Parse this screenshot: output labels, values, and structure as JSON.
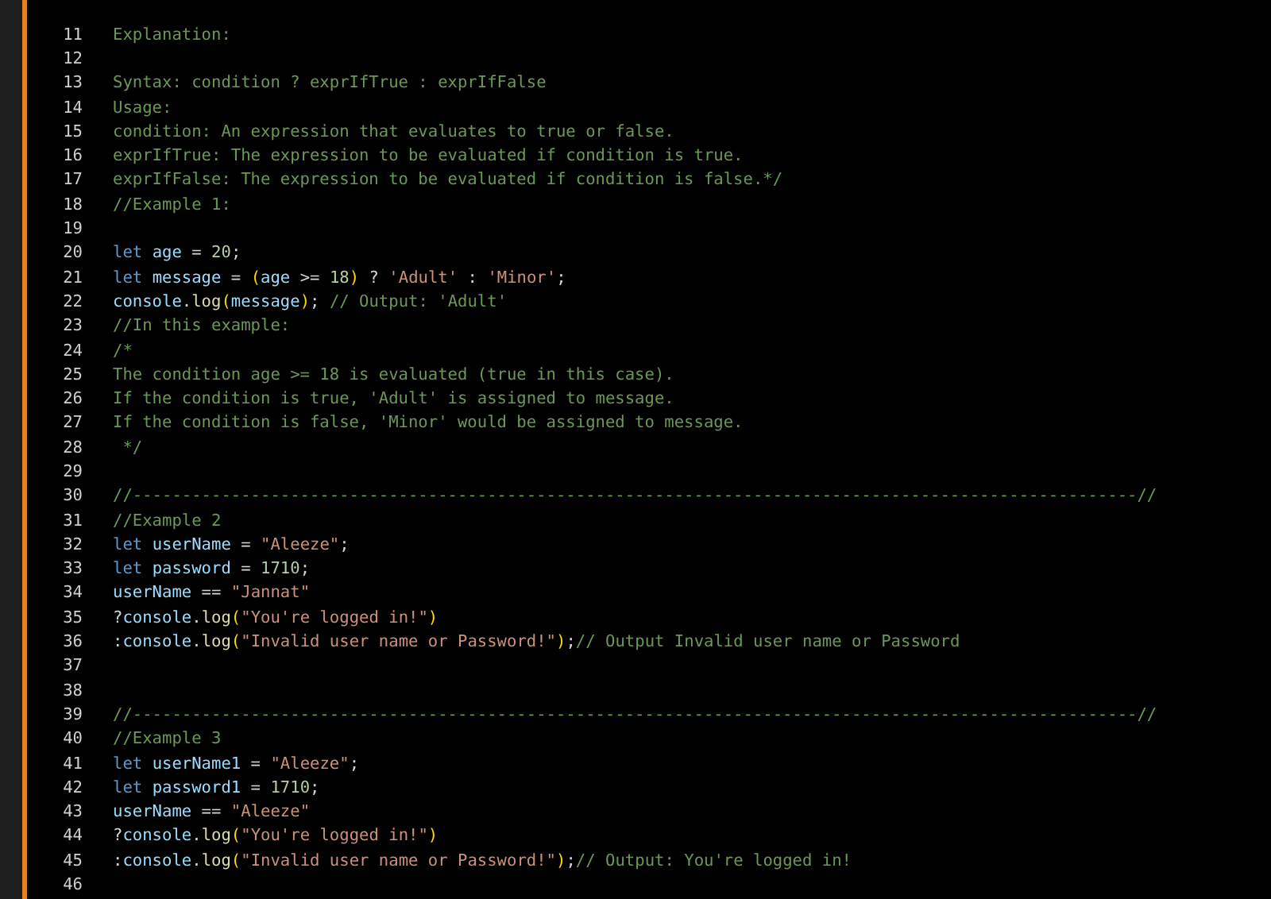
{
  "editor": {
    "lines": [
      {
        "number": "11",
        "tokens": [
          {
            "kind": "comment",
            "text": "Explanation:"
          }
        ]
      },
      {
        "number": "12"
      },
      {
        "number": "13",
        "tokens": [
          {
            "kind": "comment",
            "text": "Syntax: condition ? exprIfTrue : exprIfFalse"
          }
        ]
      },
      {
        "number": "14",
        "tokens": [
          {
            "kind": "comment",
            "text": "Usage:"
          }
        ]
      },
      {
        "number": "15",
        "tokens": [
          {
            "kind": "comment",
            "text": "condition: An expression that evaluates to true or false."
          }
        ]
      },
      {
        "number": "16",
        "tokens": [
          {
            "kind": "comment",
            "text": "exprIfTrue: The expression to be evaluated if condition is true."
          }
        ]
      },
      {
        "number": "17",
        "tokens": [
          {
            "kind": "comment",
            "text": "exprIfFalse: The expression to be evaluated if condition is false.*/"
          }
        ]
      },
      {
        "number": "18",
        "tokens": [
          {
            "kind": "comment",
            "text": "//Example 1:"
          }
        ]
      },
      {
        "number": "19"
      },
      {
        "number": "20",
        "tokens": [
          {
            "kind": "keyword",
            "text": "let "
          },
          {
            "kind": "variable",
            "text": "age"
          },
          {
            "kind": "plain",
            "text": " = "
          },
          {
            "kind": "number",
            "text": "20"
          },
          {
            "kind": "plain",
            "text": ";"
          }
        ]
      },
      {
        "number": "21",
        "tokens": [
          {
            "kind": "keyword",
            "text": "let "
          },
          {
            "kind": "variable",
            "text": "message"
          },
          {
            "kind": "plain",
            "text": " = "
          },
          {
            "kind": "paren",
            "text": "("
          },
          {
            "kind": "variable",
            "text": "age"
          },
          {
            "kind": "plain",
            "text": " >= "
          },
          {
            "kind": "number",
            "text": "18"
          },
          {
            "kind": "paren",
            "text": ")"
          },
          {
            "kind": "plain",
            "text": " ? "
          },
          {
            "kind": "string",
            "text": "'Adult'"
          },
          {
            "kind": "plain",
            "text": " : "
          },
          {
            "kind": "string",
            "text": "'Minor'"
          },
          {
            "kind": "plain",
            "text": ";"
          }
        ]
      },
      {
        "number": "22",
        "tokens": [
          {
            "kind": "variable",
            "text": "console"
          },
          {
            "kind": "plain",
            "text": "."
          },
          {
            "kind": "function",
            "text": "log"
          },
          {
            "kind": "paren",
            "text": "("
          },
          {
            "kind": "variable",
            "text": "message"
          },
          {
            "kind": "paren",
            "text": ")"
          },
          {
            "kind": "plain",
            "text": "; "
          },
          {
            "kind": "comment",
            "text": "// Output: 'Adult'"
          }
        ]
      },
      {
        "number": "23",
        "tokens": [
          {
            "kind": "comment",
            "text": "//In this example:"
          }
        ]
      },
      {
        "number": "24",
        "tokens": [
          {
            "kind": "comment",
            "text": "/*"
          }
        ]
      },
      {
        "number": "25",
        "tokens": [
          {
            "kind": "comment",
            "text": "The condition age >= 18 is evaluated (true in this case)."
          }
        ]
      },
      {
        "number": "26",
        "tokens": [
          {
            "kind": "comment",
            "text": "If the condition is true, 'Adult' is assigned to message."
          }
        ]
      },
      {
        "number": "27",
        "tokens": [
          {
            "kind": "comment",
            "text": "If the condition is false, 'Minor' would be assigned to message."
          }
        ]
      },
      {
        "number": "28",
        "tokens": [
          {
            "kind": "comment",
            "text": " */"
          }
        ]
      },
      {
        "number": "29"
      },
      {
        "number": "30",
        "tokens": [
          {
            "kind": "comment",
            "text": "//------------------------------------------------------------------------------------------------------//"
          }
        ]
      },
      {
        "number": "31",
        "tokens": [
          {
            "kind": "comment",
            "text": "//Example 2"
          }
        ]
      },
      {
        "number": "32",
        "tokens": [
          {
            "kind": "keyword",
            "text": "let "
          },
          {
            "kind": "variable",
            "text": "userName"
          },
          {
            "kind": "plain",
            "text": " = "
          },
          {
            "kind": "string",
            "text": "\"Aleeze\""
          },
          {
            "kind": "plain",
            "text": ";"
          }
        ]
      },
      {
        "number": "33",
        "tokens": [
          {
            "kind": "keyword",
            "text": "let "
          },
          {
            "kind": "variable",
            "text": "password"
          },
          {
            "kind": "plain",
            "text": " = "
          },
          {
            "kind": "number",
            "text": "1710"
          },
          {
            "kind": "plain",
            "text": ";"
          }
        ]
      },
      {
        "number": "34",
        "tokens": [
          {
            "kind": "variable",
            "text": "userName"
          },
          {
            "kind": "plain",
            "text": " == "
          },
          {
            "kind": "string",
            "text": "\"Jannat\""
          }
        ]
      },
      {
        "number": "35",
        "tokens": [
          {
            "kind": "plain",
            "text": "?"
          },
          {
            "kind": "variable",
            "text": "console"
          },
          {
            "kind": "plain",
            "text": "."
          },
          {
            "kind": "function",
            "text": "log"
          },
          {
            "kind": "paren",
            "text": "("
          },
          {
            "kind": "string",
            "text": "\"You're logged in!\""
          },
          {
            "kind": "paren",
            "text": ")"
          }
        ]
      },
      {
        "number": "36",
        "tokens": [
          {
            "kind": "plain",
            "text": ":"
          },
          {
            "kind": "variable",
            "text": "console"
          },
          {
            "kind": "plain",
            "text": "."
          },
          {
            "kind": "function",
            "text": "log"
          },
          {
            "kind": "paren",
            "text": "("
          },
          {
            "kind": "string",
            "text": "\"Invalid user name or Password!\""
          },
          {
            "kind": "paren",
            "text": ")"
          },
          {
            "kind": "plain",
            "text": ";"
          },
          {
            "kind": "comment",
            "text": "// Output Invalid user name or Password"
          }
        ]
      },
      {
        "number": "37"
      },
      {
        "number": "38"
      },
      {
        "number": "39",
        "tokens": [
          {
            "kind": "comment",
            "text": "//------------------------------------------------------------------------------------------------------//"
          }
        ]
      },
      {
        "number": "40",
        "tokens": [
          {
            "kind": "comment",
            "text": "//Example 3"
          }
        ]
      },
      {
        "number": "41",
        "tokens": [
          {
            "kind": "keyword",
            "text": "let "
          },
          {
            "kind": "variable",
            "text": "userName1"
          },
          {
            "kind": "plain",
            "text": " = "
          },
          {
            "kind": "string",
            "text": "\"Aleeze\""
          },
          {
            "kind": "plain",
            "text": ";"
          }
        ]
      },
      {
        "number": "42",
        "tokens": [
          {
            "kind": "keyword",
            "text": "let "
          },
          {
            "kind": "variable",
            "text": "password1"
          },
          {
            "kind": "plain",
            "text": " = "
          },
          {
            "kind": "number",
            "text": "1710"
          },
          {
            "kind": "plain",
            "text": ";"
          }
        ]
      },
      {
        "number": "43",
        "tokens": [
          {
            "kind": "variable",
            "text": "userName"
          },
          {
            "kind": "plain",
            "text": " == "
          },
          {
            "kind": "string",
            "text": "\"Aleeze\""
          }
        ]
      },
      {
        "number": "44",
        "tokens": [
          {
            "kind": "plain",
            "text": "?"
          },
          {
            "kind": "variable",
            "text": "console"
          },
          {
            "kind": "plain",
            "text": "."
          },
          {
            "kind": "function",
            "text": "log"
          },
          {
            "kind": "paren",
            "text": "("
          },
          {
            "kind": "string",
            "text": "\"You're logged in!\""
          },
          {
            "kind": "paren",
            "text": ")"
          }
        ]
      },
      {
        "number": "45",
        "tokens": [
          {
            "kind": "plain",
            "text": ":"
          },
          {
            "kind": "variable",
            "text": "console"
          },
          {
            "kind": "plain",
            "text": "."
          },
          {
            "kind": "function",
            "text": "log"
          },
          {
            "kind": "paren",
            "text": "("
          },
          {
            "kind": "string",
            "text": "\"Invalid user name or Password!\""
          },
          {
            "kind": "paren",
            "text": ")"
          },
          {
            "kind": "plain",
            "text": ";"
          },
          {
            "kind": "comment",
            "text": "// Output: You're logged in!"
          }
        ]
      },
      {
        "number": "46"
      }
    ]
  }
}
